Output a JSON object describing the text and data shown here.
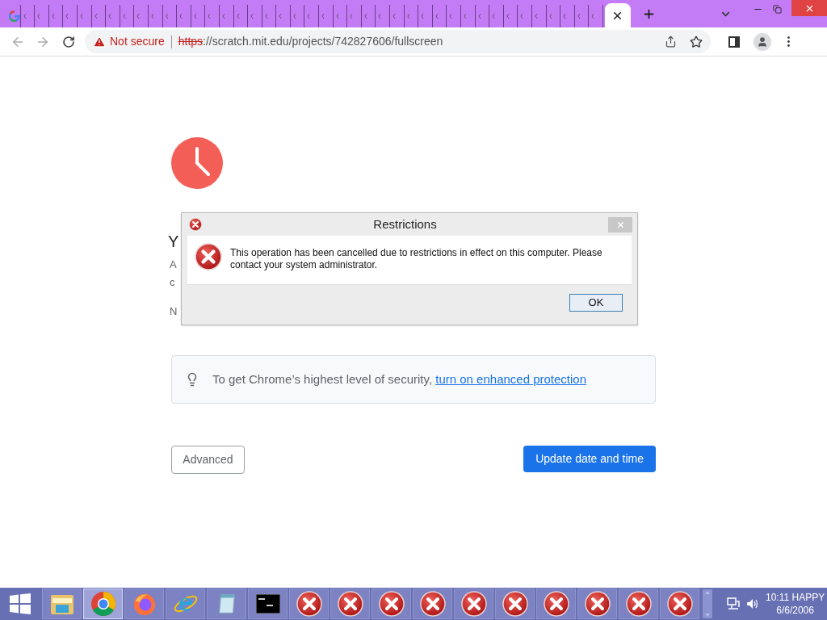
{
  "tabs": [
    {
      "selected": false
    },
    {
      "selected": false
    },
    {
      "selected": false
    },
    {
      "selected": false
    },
    {
      "selected": false
    },
    {
      "selected": false
    },
    {
      "selected": false
    },
    {
      "selected": false
    },
    {
      "selected": false
    },
    {
      "selected": false
    },
    {
      "selected": false
    },
    {
      "selected": false
    },
    {
      "selected": false
    },
    {
      "selected": false
    },
    {
      "selected": false
    },
    {
      "selected": false
    },
    {
      "selected": false
    },
    {
      "selected": false
    },
    {
      "selected": false
    },
    {
      "selected": false
    },
    {
      "selected": false
    },
    {
      "selected": false
    },
    {
      "selected": false
    },
    {
      "selected": false
    },
    {
      "selected": false
    },
    {
      "selected": false
    },
    {
      "selected": false
    },
    {
      "selected": false
    },
    {
      "selected": false
    },
    {
      "selected": false
    },
    {
      "selected": false
    },
    {
      "selected": false
    },
    {
      "selected": false
    },
    {
      "selected": false
    },
    {
      "selected": false
    },
    {
      "selected": false
    },
    {
      "selected": false
    },
    {
      "selected": false
    },
    {
      "selected": false
    },
    {
      "selected": false
    },
    {
      "selected": false
    },
    {
      "selected": false
    },
    {
      "selected": true
    }
  ],
  "address_bar": {
    "security_label": "Not secure",
    "scheme": "https",
    "url_rest": "://scratch.mit.edu/projects/742827606/fullscreen"
  },
  "page": {
    "partial_texts": [
      "Y",
      "A",
      "c",
      "N"
    ],
    "info": {
      "text": "To get Chrome’s highest level of security, ",
      "link": "turn on enhanced protection"
    },
    "buttons": [
      {
        "label": "Advanced",
        "kind": "secondary"
      },
      {
        "label": "Update date and time",
        "kind": "primary"
      }
    ]
  },
  "dialog": {
    "title": "Restrictions",
    "message": "This operation has been cancelled due to restrictions in effect on this computer. Please contact your system administrator.",
    "button": "OK"
  },
  "taskbar": {
    "items": [
      {
        "kind": "explorer",
        "selected": false
      },
      {
        "kind": "chrome",
        "selected": true
      },
      {
        "kind": "firefox",
        "selected": false
      },
      {
        "kind": "ie",
        "selected": false
      },
      {
        "kind": "notepad",
        "selected": false
      },
      {
        "kind": "cmd",
        "selected": false
      },
      {
        "kind": "error",
        "selected": false
      },
      {
        "kind": "error",
        "selected": false
      },
      {
        "kind": "error",
        "selected": false
      },
      {
        "kind": "error",
        "selected": false
      },
      {
        "kind": "error",
        "selected": false
      },
      {
        "kind": "error",
        "selected": false
      },
      {
        "kind": "error",
        "selected": false
      },
      {
        "kind": "error",
        "selected": false
      },
      {
        "kind": "error",
        "selected": false
      },
      {
        "kind": "error",
        "selected": false
      }
    ],
    "time": "10:11 HAPPY",
    "date": "6/6/2006"
  }
}
